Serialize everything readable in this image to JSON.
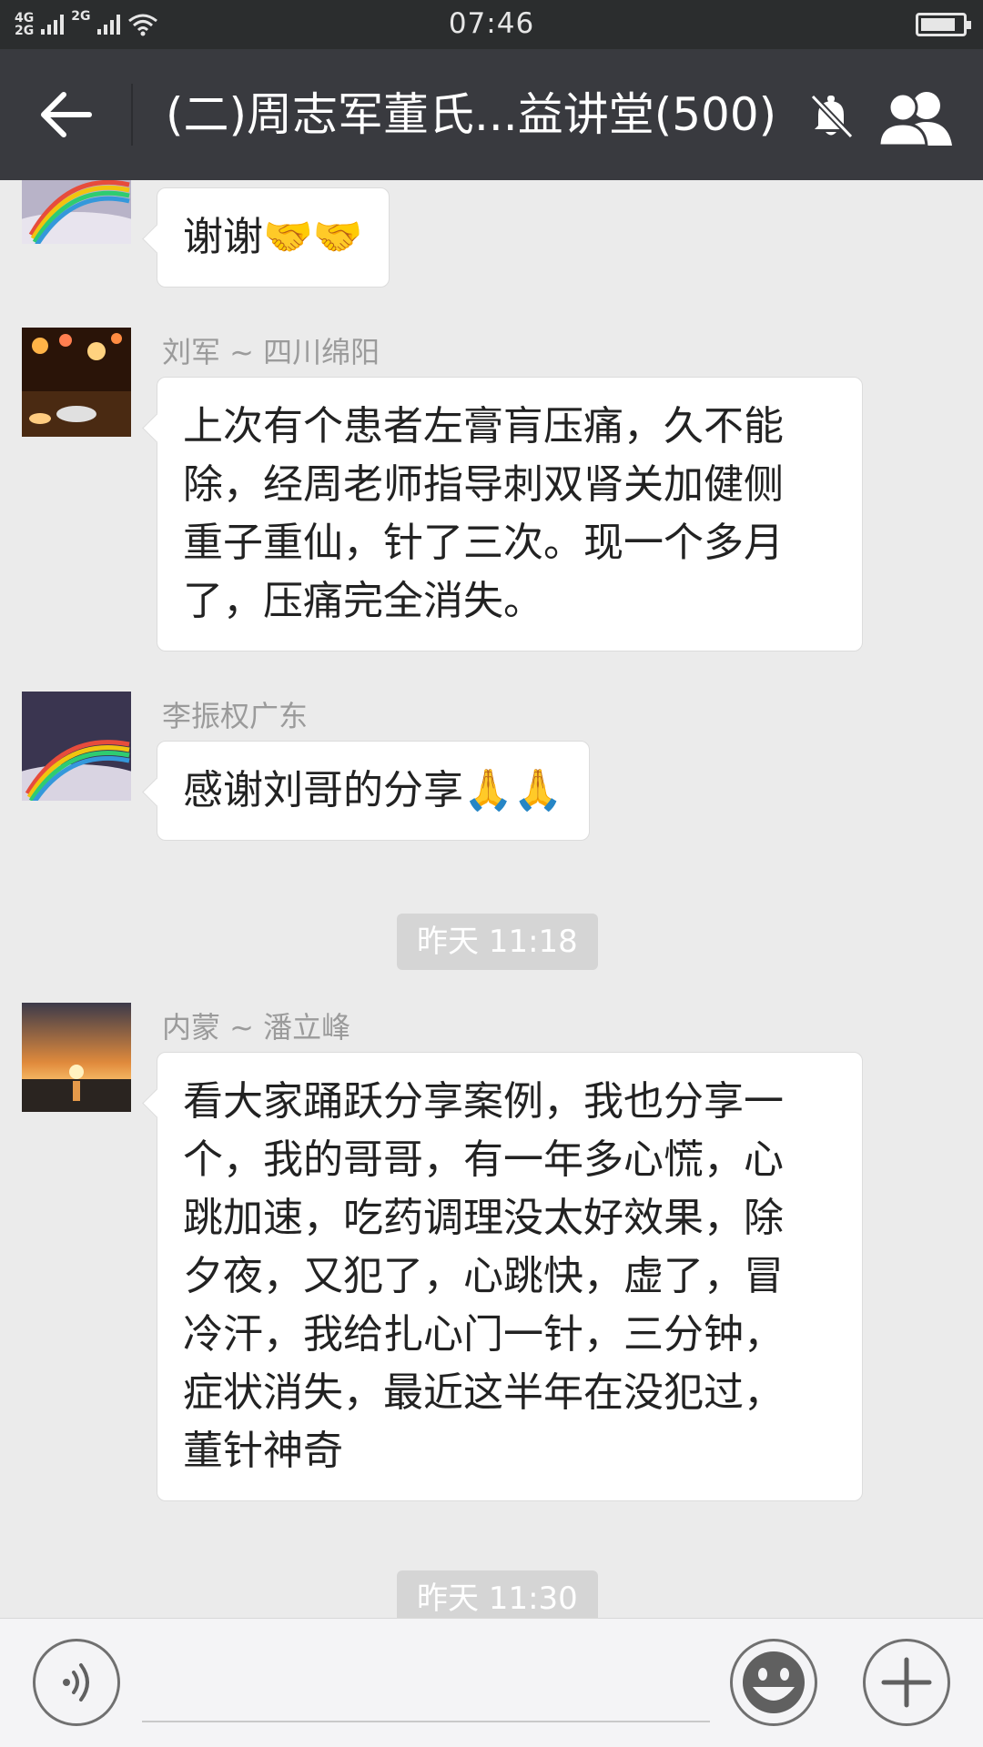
{
  "status_bar": {
    "network_top": "4G",
    "network_bottom": "2G",
    "network_right": "2G",
    "time": "07:46"
  },
  "header": {
    "title": "(二)周志军董氏...益讲堂(500)"
  },
  "messages": [
    {
      "sender": "",
      "text": "谢谢",
      "emoji": "🤝🤝"
    },
    {
      "sender": "刘军 ~ 四川绵阳",
      "lines": [
        "上次有个患者左膏肓压痛，久不能",
        "除，经周老师指导刺双肾关加健侧",
        "重子重仙，针了三次。现一个多月",
        "了，压痛完全消失。"
      ]
    },
    {
      "sender": "李振权广东",
      "text": "感谢刘哥的分享",
      "emoji": "🙏🙏"
    },
    {
      "sender": "内蒙 ~ 潘立峰",
      "lines": [
        "看大家踊跃分享案例，我也分享一",
        "个，我的哥哥，有一年多心慌，心",
        "跳加速，吃药调理没太好效果，除",
        "夕夜，又犯了，心跳快，虚了，冒",
        "冷汗，我给扎心门一针，三分钟，",
        "症状消失，最近这半年在没犯过，",
        "董针神奇"
      ]
    }
  ],
  "timestamps": [
    "昨天 11:18",
    "昨天 11:30"
  ],
  "input": {
    "placeholder": ""
  },
  "colors": {
    "status_bar": "#2b2d2e",
    "title_bar": "#393a3f",
    "chat_bg": "#ebebeb",
    "bubble": "#ffffff"
  }
}
